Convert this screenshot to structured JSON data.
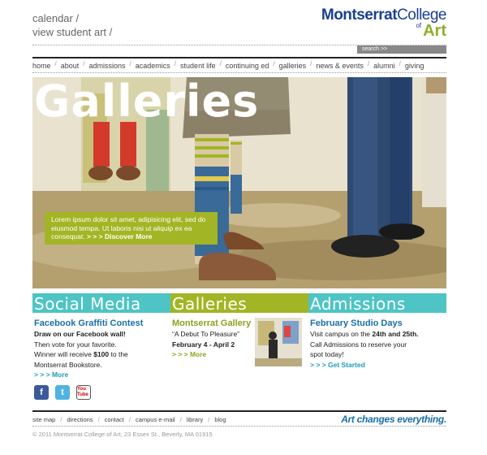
{
  "header": {
    "top_links": [
      "calendar /",
      "view student art /"
    ],
    "logo": {
      "part1": "Montserrat",
      "part2": "College",
      "of": "of",
      "art": "Art"
    },
    "search_label": "search >>"
  },
  "nav": {
    "items": [
      "home",
      "about",
      "admissions",
      "academics",
      "student life",
      "continuing ed",
      "galleries",
      "news & events",
      "alumni",
      "giving"
    ],
    "separator": "/"
  },
  "hero": {
    "title": "Galleries",
    "caption": "Lorem ipsum dolor sit amet, adipisicing elit, sed do eiusmod tempa. Ut laboris nisi ut aliquip ex ea consequat.",
    "link": "> > > Discover More"
  },
  "columns": {
    "social": {
      "band": "Social Media",
      "heading": "Facebook Graffiti Contest",
      "bold_line": "Draw on our Facebook wall!",
      "line2": "Then vote for your favorite.",
      "line3_pre": "Winner will receive ",
      "line3_bold": "$100",
      "line3_post": " to the",
      "line4": "Montserrat Bookstore.",
      "more": "> > > More",
      "icons": [
        {
          "name": "facebook-icon",
          "glyph": "f"
        },
        {
          "name": "twitter-icon",
          "glyph": "t"
        },
        {
          "name": "youtube-icon",
          "glyph": "You Tube"
        }
      ]
    },
    "galleries": {
      "band": "Galleries",
      "heading": "Montserrat Gallery",
      "subtitle": "“A Debut To Pleasure”",
      "dates": "February 4 - April 2",
      "more": "> > > More"
    },
    "admissions": {
      "band": "Admissions",
      "heading": "February Studio Days",
      "line1_pre": "Visit campus on the ",
      "line1_b1": "24th and 25th.",
      "line2": "Call Admissions to reserve your",
      "line3": "spot today!",
      "more": "> > > Get Started"
    }
  },
  "footer": {
    "links": [
      "site map",
      "directions",
      "contact",
      "campus e-mail",
      "library",
      "blog"
    ],
    "separator": "/",
    "tagline": "Art changes everything.",
    "copyright": "© 2011 Montserrat College of Art, 23 Essex St., Beverly, MA 01915"
  },
  "colors": {
    "blue": "#1b3f8f",
    "green": "#a2b524",
    "teal": "#4ec4c4"
  }
}
